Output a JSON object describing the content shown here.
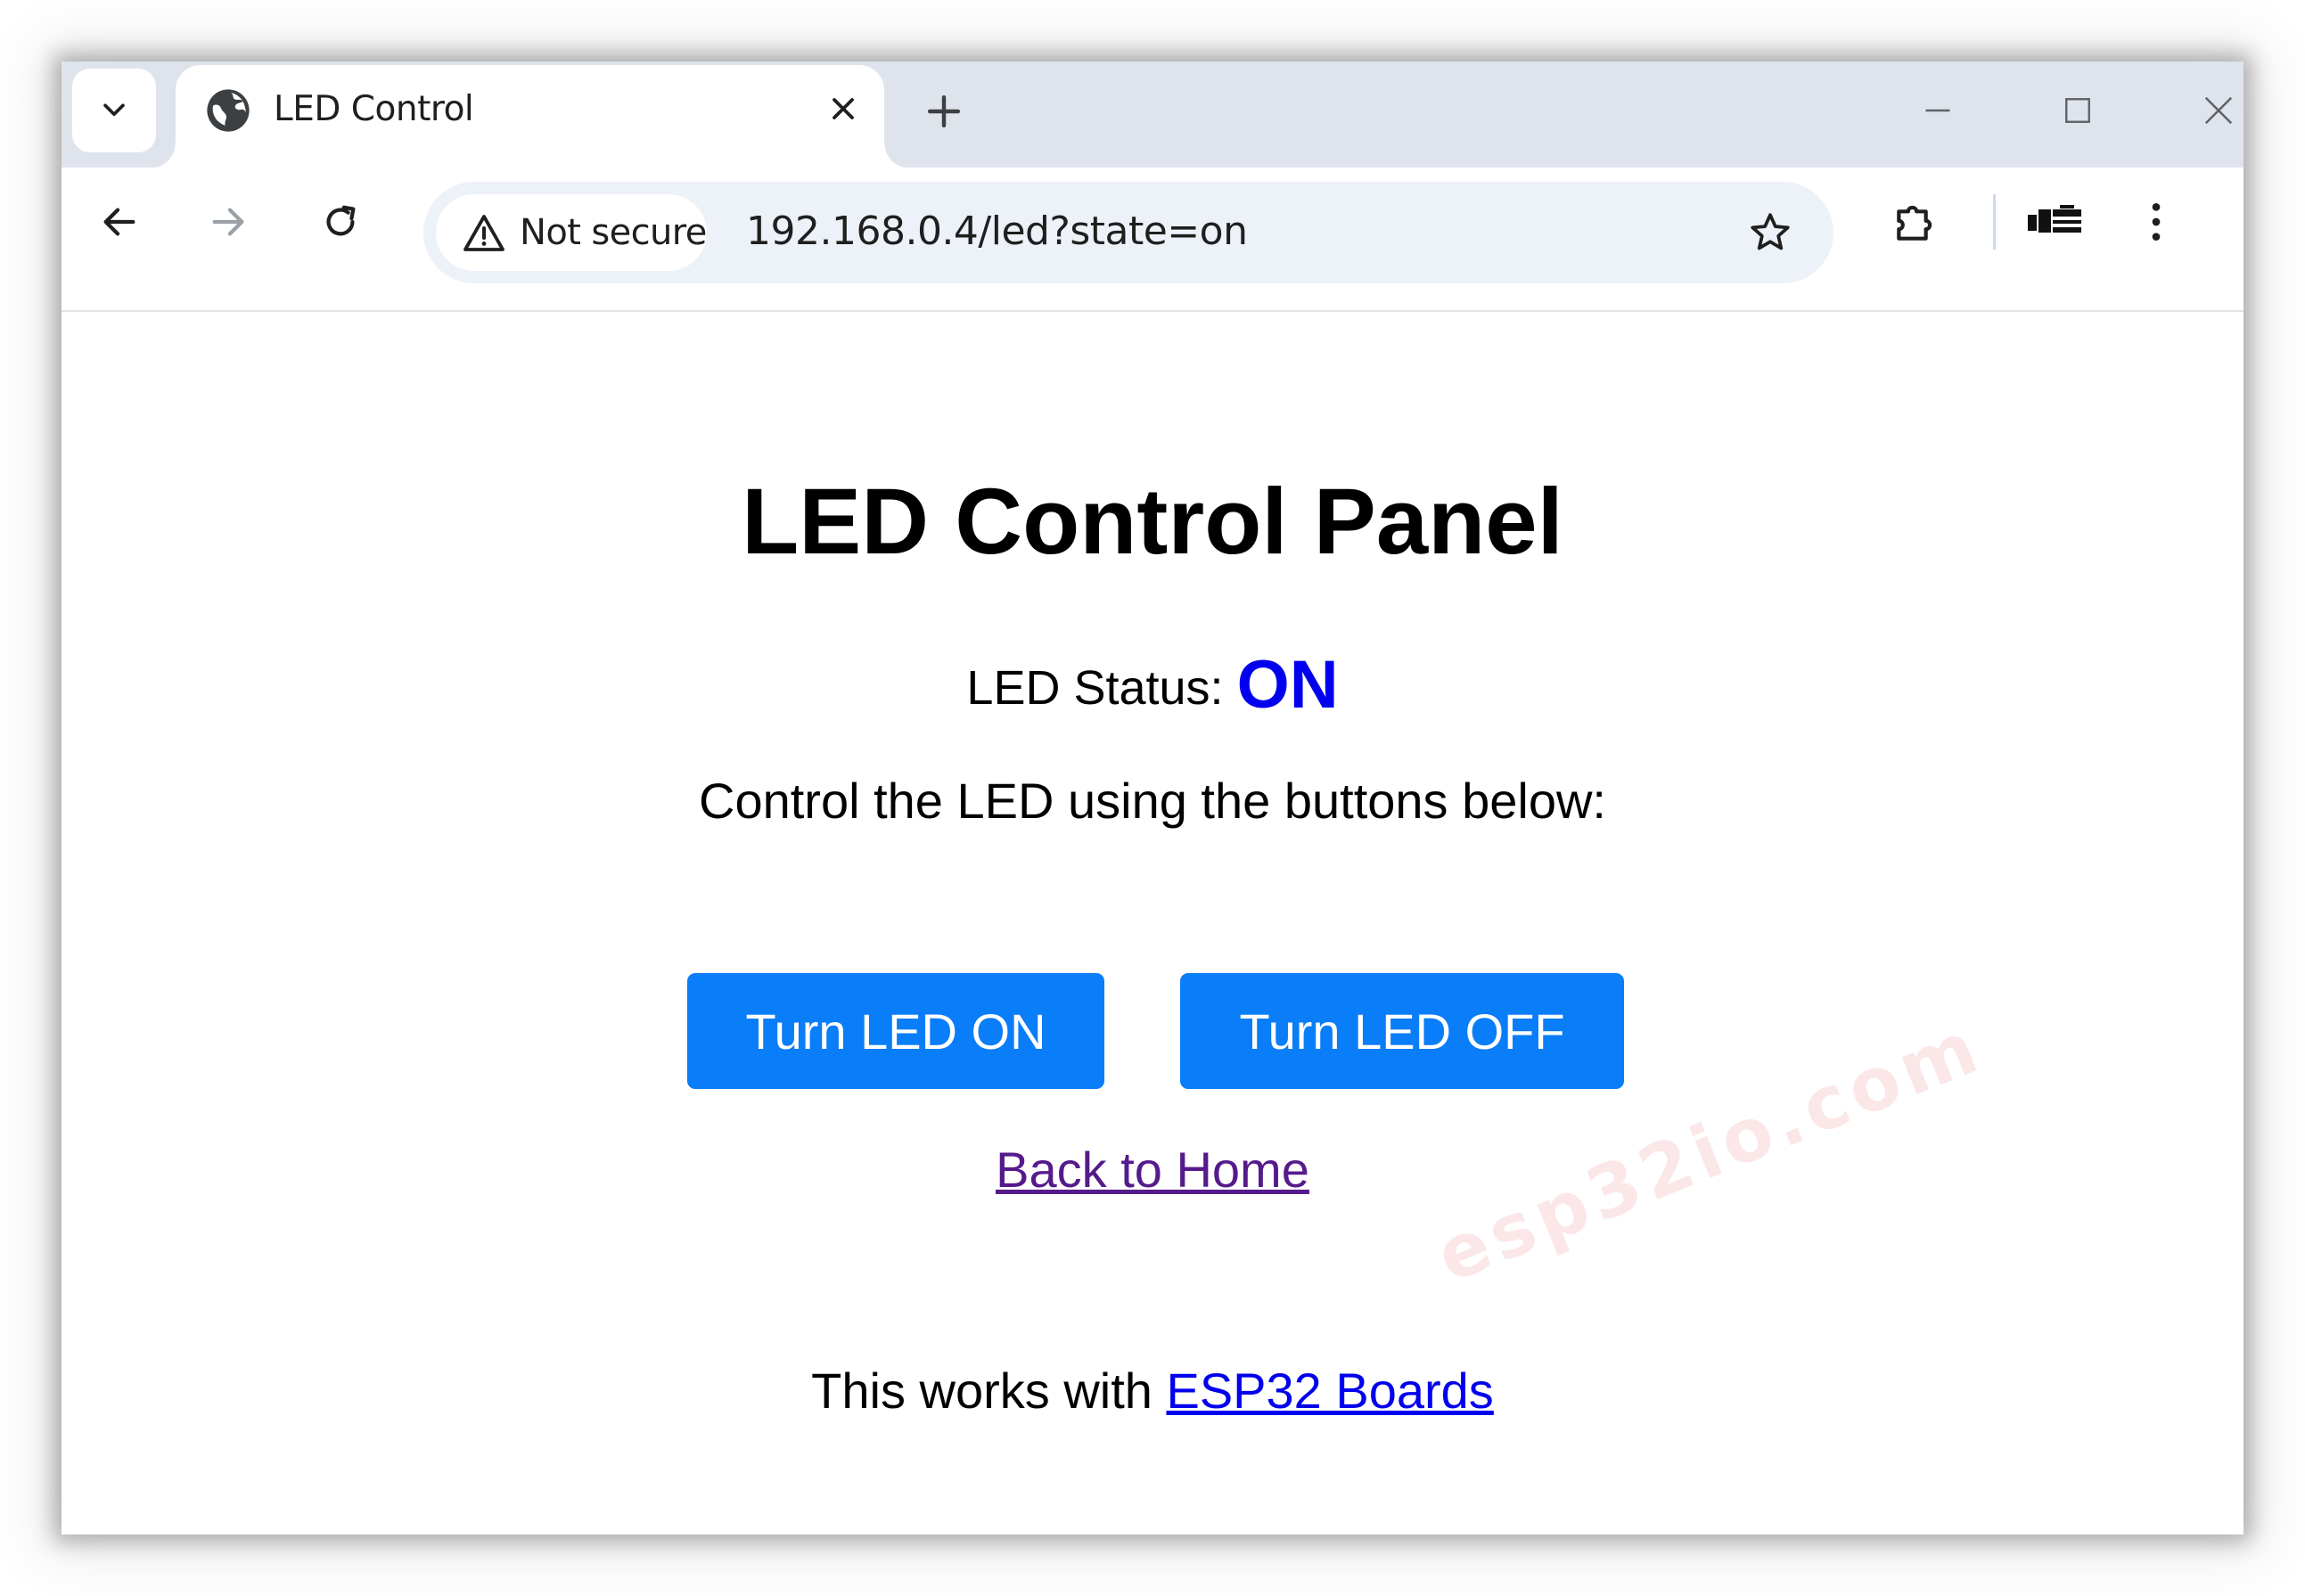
{
  "browser": {
    "tab_title": "LED Control",
    "url": "192.168.0.4/led?state=on",
    "security_label": "Not secure"
  },
  "page": {
    "heading": "LED Control Panel",
    "status_label": "LED Status:",
    "status_value": "ON",
    "instructions": "Control the LED using the buttons below:",
    "button_on": "Turn LED ON",
    "button_off": "Turn LED OFF",
    "back_link": "Back to Home",
    "footer_prefix": "This works with",
    "footer_link": "ESP32 Boards"
  },
  "watermark": "esp32io.com",
  "colors": {
    "button_blue": "#0a7df8",
    "status_blue": "#0000ee",
    "visited_link": "#551a8b"
  }
}
